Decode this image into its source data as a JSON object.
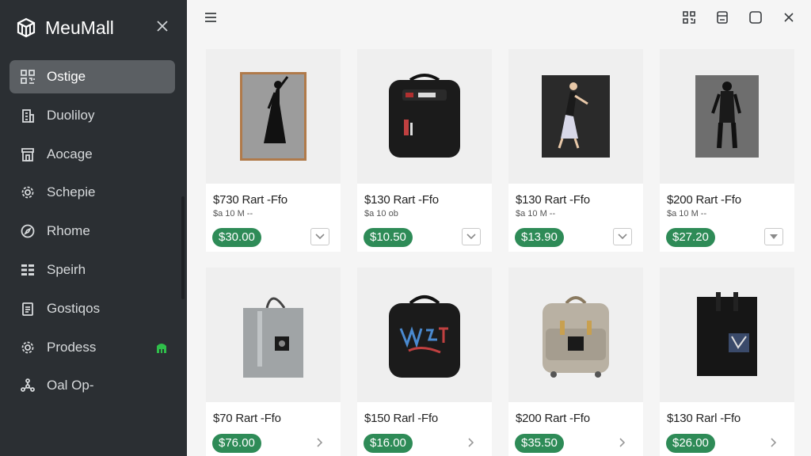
{
  "app": {
    "name": "MeuMall",
    "brand_icon": "box-logo-icon",
    "close_icon": "close-icon"
  },
  "sidebar": {
    "items": [
      {
        "label": "Ostige",
        "icon": "grid-qr-icon",
        "active": true
      },
      {
        "label": "Duoliloy",
        "icon": "building-icon",
        "active": false
      },
      {
        "label": "Aocage",
        "icon": "storefront-icon",
        "active": false
      },
      {
        "label": "Schepie",
        "icon": "gear-icon",
        "active": false
      },
      {
        "label": "Rhome",
        "icon": "compass-icon",
        "active": false
      },
      {
        "label": "Speirh",
        "icon": "list-grid-icon",
        "active": false
      },
      {
        "label": "Gostiqos",
        "icon": "clipboard-icon",
        "active": false
      },
      {
        "label": "Prodess",
        "icon": "gear-icon",
        "active": false,
        "badge": "green-bag-icon"
      },
      {
        "label": "Oal Op-",
        "icon": "network-icon",
        "active": false
      }
    ]
  },
  "topbar": {
    "menu_icon": "hamburger-icon",
    "icons": [
      "qr-icon",
      "printer-icon",
      "window-icon",
      "close-icon"
    ]
  },
  "products": [
    {
      "title": "$730 Rart -Ffo",
      "sub": "$a 10 M --",
      "price": "$30.00",
      "image": "woman-silhouette-canvas"
    },
    {
      "title": "$130 Rart -Ffo",
      "sub": "$a 10 ob",
      "price": "$10.50",
      "image": "black-backpack"
    },
    {
      "title": "$130 Rart -Ffo",
      "sub": "$a 10 M --",
      "price": "$13.90",
      "image": "dancer-print-tote"
    },
    {
      "title": "$200 Rart -Ffo",
      "sub": "$a 10 M --",
      "price": "$27.20",
      "image": "figure-print-canvas"
    },
    {
      "title": "$70 Rart -Ffo",
      "sub": "",
      "price": "$76.00",
      "image": "grey-tote-bag"
    },
    {
      "title": "$150 Rarl -Ffo",
      "sub": "",
      "price": "$16.00",
      "image": "graffiti-backpack"
    },
    {
      "title": "$200 Rart -Ffo",
      "sub": "",
      "price": "$35.50",
      "image": "beige-backpack"
    },
    {
      "title": "$130 Rarl -Ffo",
      "sub": "",
      "price": "$26.00",
      "image": "black-tote-bag"
    }
  ],
  "colors": {
    "sidebar_bg": "#2b2f33",
    "active_item": "#5b5f63",
    "price_green": "#2e8b57",
    "badge_green": "#2fbf4a"
  }
}
